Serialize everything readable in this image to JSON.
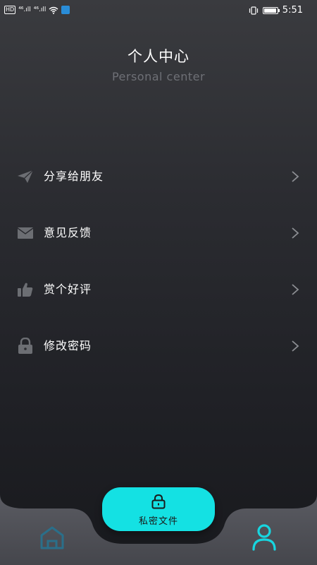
{
  "status_bar": {
    "left_badge": "HD",
    "network_1": "⁴⁶.ıll",
    "network_2": "⁴⁶.ıll",
    "time": "5:51"
  },
  "header": {
    "title": "个人中心",
    "subtitle": "Personal center"
  },
  "menu": {
    "items": [
      {
        "label": "分享给朋友",
        "icon": "paper-plane-icon"
      },
      {
        "label": "意见反馈",
        "icon": "mail-icon"
      },
      {
        "label": "赏个好评",
        "icon": "thumbs-up-icon"
      },
      {
        "label": "修改密码",
        "icon": "lock-icon"
      }
    ]
  },
  "bottom_nav": {
    "center_button_label": "私密文件",
    "home_icon": "home-icon",
    "user_icon": "user-icon",
    "accent_color": "#14e1e3"
  }
}
